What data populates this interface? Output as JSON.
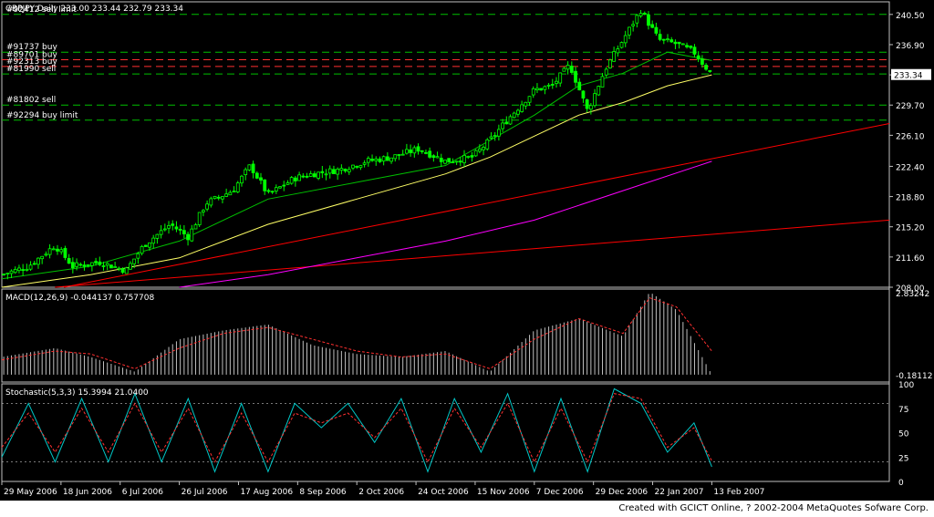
{
  "colors": {
    "background": "#000000",
    "frame": "#c0c0c0",
    "text": "#ffffff",
    "candle": "#00ff00",
    "ma_fast": "#00c000",
    "ma_slow": "#ffff66",
    "ma_long": "#ff00ff",
    "trendline": "#ff0000",
    "level_green": "#00c000",
    "level_red": "#ff3030",
    "macd_hist": "#c0c0c0",
    "macd_signal": "#ff3030",
    "stoch_main": "#00c8c8",
    "stoch_signal": "#ff3030"
  },
  "chart_data": {
    "type": "candlestick",
    "header": {
      "symbol": "GBPJPY,Daily",
      "ohlc": "233.00 233.44 232.79 233.34"
    },
    "price_axis": {
      "ylim": [
        208.0,
        242.0
      ],
      "ticks": [
        "240.50",
        "236.90",
        "233.30",
        "229.70",
        "226.10",
        "222.40",
        "218.80",
        "215.20",
        "211.60",
        "208.00"
      ],
      "current_price": "233.34"
    },
    "order_levels": [
      {
        "label": "#92412 sell limit",
        "price": 240.5,
        "color": "green"
      },
      {
        "label": "#91737 buy",
        "price": 236.0,
        "color": "green"
      },
      {
        "label": "#89701 buy",
        "price": 235.1,
        "color": "red"
      },
      {
        "label": "#92313 buy",
        "price": 234.3,
        "color": "red"
      },
      {
        "label": "#81990 sell",
        "price": 233.4,
        "color": "green"
      },
      {
        "label": "#81802 sell",
        "price": 229.7,
        "color": "green"
      },
      {
        "label": "#92294 buy limit",
        "price": 227.9,
        "color": "green"
      }
    ],
    "series": [
      {
        "name": "price",
        "kind": "close_path",
        "x": [
          0,
          0.03,
          0.06,
          0.08,
          0.11,
          0.14,
          0.16,
          0.19,
          0.21,
          0.23,
          0.26,
          0.28,
          0.3,
          0.33,
          0.35,
          0.38,
          0.41,
          0.44,
          0.47,
          0.5,
          0.53,
          0.55,
          0.57,
          0.6,
          0.62,
          0.64,
          0.66,
          0.68,
          0.7,
          0.72,
          0.74,
          0.76,
          0.78,
          0.8
        ],
        "y": [
          209.5,
          210.5,
          213.0,
          210.5,
          211.0,
          210.0,
          213.0,
          215.5,
          214.0,
          218.0,
          219.5,
          222.5,
          219.0,
          221.0,
          221.5,
          222.0,
          223.0,
          223.5,
          224.5,
          223.0,
          223.5,
          225.5,
          228.0,
          231.5,
          232.0,
          234.5,
          229.0,
          234.0,
          237.5,
          241.0,
          237.5,
          237.0,
          236.0,
          233.3
        ]
      },
      {
        "name": "ma_fast",
        "x": [
          0,
          0.1,
          0.2,
          0.3,
          0.4,
          0.5,
          0.55,
          0.6,
          0.65,
          0.7,
          0.75,
          0.8
        ],
        "y": [
          209.0,
          210.5,
          213.5,
          218.5,
          220.5,
          222.5,
          225.5,
          228.5,
          232.0,
          233.5,
          236.0,
          235.0
        ]
      },
      {
        "name": "ma_slow",
        "x": [
          0,
          0.1,
          0.2,
          0.3,
          0.4,
          0.5,
          0.55,
          0.6,
          0.65,
          0.7,
          0.75,
          0.8
        ],
        "y": [
          208.0,
          209.5,
          211.5,
          215.5,
          218.5,
          221.5,
          223.5,
          226.0,
          228.5,
          230.0,
          232.0,
          233.3
        ]
      },
      {
        "name": "ma_long",
        "x": [
          0.2,
          0.3,
          0.4,
          0.5,
          0.6,
          0.7,
          0.8
        ],
        "y": [
          208.0,
          209.5,
          211.5,
          213.5,
          216.0,
          219.5,
          223.0
        ]
      }
    ],
    "trendlines": [
      {
        "x": [
          0.07,
          1.0
        ],
        "y": [
          208.0,
          227.5
        ]
      },
      {
        "x": [
          0.06,
          1.0
        ],
        "y": [
          208.0,
          216.0
        ]
      }
    ],
    "macd": {
      "label": "MACD(12,26,9)",
      "values": "-0.044137  0.757708",
      "ticks": [
        "2.83242",
        "-0.18112"
      ],
      "ylim": [
        -0.25,
        2.9
      ],
      "x": [
        0,
        0.06,
        0.1,
        0.15,
        0.2,
        0.25,
        0.3,
        0.35,
        0.4,
        0.45,
        0.5,
        0.55,
        0.6,
        0.65,
        0.7,
        0.73,
        0.76,
        0.8
      ],
      "hist": [
        0.6,
        0.9,
        0.6,
        0.1,
        1.2,
        1.5,
        1.7,
        1.0,
        0.7,
        0.6,
        0.8,
        0.1,
        1.5,
        1.9,
        1.3,
        2.8,
        2.2,
        0.0
      ],
      "signal": [
        0.5,
        0.8,
        0.7,
        0.2,
        0.9,
        1.4,
        1.6,
        1.2,
        0.8,
        0.6,
        0.7,
        0.2,
        1.2,
        1.9,
        1.4,
        2.6,
        2.3,
        0.8
      ]
    },
    "stochastic": {
      "label": "Stochastic(5,3,3)",
      "values": "15.3994  21.0400",
      "ticks": [
        "100",
        "75",
        "50",
        "25",
        "0"
      ],
      "ylim": [
        0,
        100
      ],
      "x": [
        0,
        0.03,
        0.06,
        0.09,
        0.12,
        0.15,
        0.18,
        0.21,
        0.24,
        0.27,
        0.3,
        0.33,
        0.36,
        0.39,
        0.42,
        0.45,
        0.48,
        0.51,
        0.54,
        0.57,
        0.6,
        0.63,
        0.66,
        0.69,
        0.72,
        0.75,
        0.78,
        0.8
      ],
      "main": [
        25,
        80,
        20,
        85,
        20,
        90,
        20,
        85,
        10,
        80,
        10,
        80,
        55,
        80,
        40,
        85,
        10,
        85,
        30,
        90,
        10,
        85,
        10,
        95,
        80,
        30,
        60,
        15
      ],
      "signal": [
        35,
        70,
        30,
        75,
        30,
        80,
        30,
        75,
        20,
        70,
        20,
        70,
        60,
        70,
        45,
        75,
        20,
        75,
        35,
        80,
        20,
        75,
        20,
        90,
        85,
        35,
        55,
        21
      ]
    },
    "x_axis": {
      "tick_labels": [
        "29 May 2006",
        "18 Jun 2006",
        "6 Jul 2006",
        "26 Jul 2006",
        "17 Aug 2006",
        "8 Sep 2006",
        "2 Oct 2006",
        "24 Oct 2006",
        "15 Nov 2006",
        "7 Dec 2006",
        "29 Dec 2006",
        "22 Jan 2007",
        "13 Feb 2007"
      ]
    }
  },
  "footer": "Created with GCICT Online, ? 2002-2004 MetaQuotes Sofware Corp."
}
